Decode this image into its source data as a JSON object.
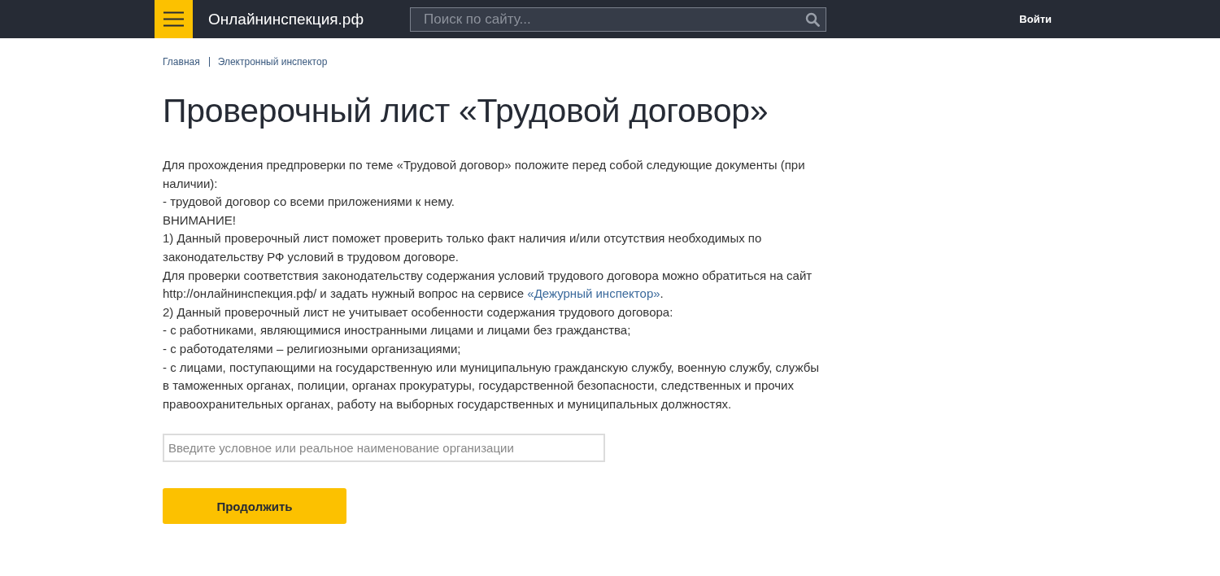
{
  "header": {
    "site_name": "Онлайнинспекция.рф",
    "search": {
      "placeholder": "Поиск по сайту..."
    },
    "login": "Войти"
  },
  "breadcrumbs": [
    {
      "label": "Главная"
    },
    {
      "label": "Электронный инспектор"
    }
  ],
  "title": "Проверочный лист «Трудовой договор»",
  "intro": [
    {
      "text": "Для прохождения предпроверки по теме «Трудовой договор» положите перед собой следующие документы (при наличии):"
    },
    {
      "text": "- трудовой договор со всеми приложениями к нему."
    },
    {
      "text": "ВНИМАНИЕ!"
    },
    {
      "text": "1) Данный проверочный лист поможет проверить только факт наличия и/или отсутствия необходимых по законодательству РФ условий в трудовом договоре."
    },
    {
      "text": "Для проверки соответствия законодательству содержания условий трудового договора можно обратиться на сайт http://онлайнинспекция.рф/ и задать нужный вопрос на сервисе ",
      "link": "«Дежурный инспектор»",
      "after": "."
    },
    {
      "text": "2) Данный проверочный лист не учитывает особенности содержания трудового договора:"
    },
    {
      "text": "- с работниками, являющимися иностранными лицами и лицами без гражданства;"
    },
    {
      "text": "- с работодателями – религиозными организациями;"
    },
    {
      "text": "- с лицами, поступающими на государственную или муниципальную гражданскую службу, военную службу, службы в таможенных органах, полиции, органах прокуратуры, государственной безопасности, следственных и прочих правоохранительных органах, работу на выборных государственных и муниципальных должностях."
    }
  ],
  "organization_field": {
    "placeholder": "Введите условное или реальное наименование организации"
  },
  "continue_button": "Продолжить"
}
